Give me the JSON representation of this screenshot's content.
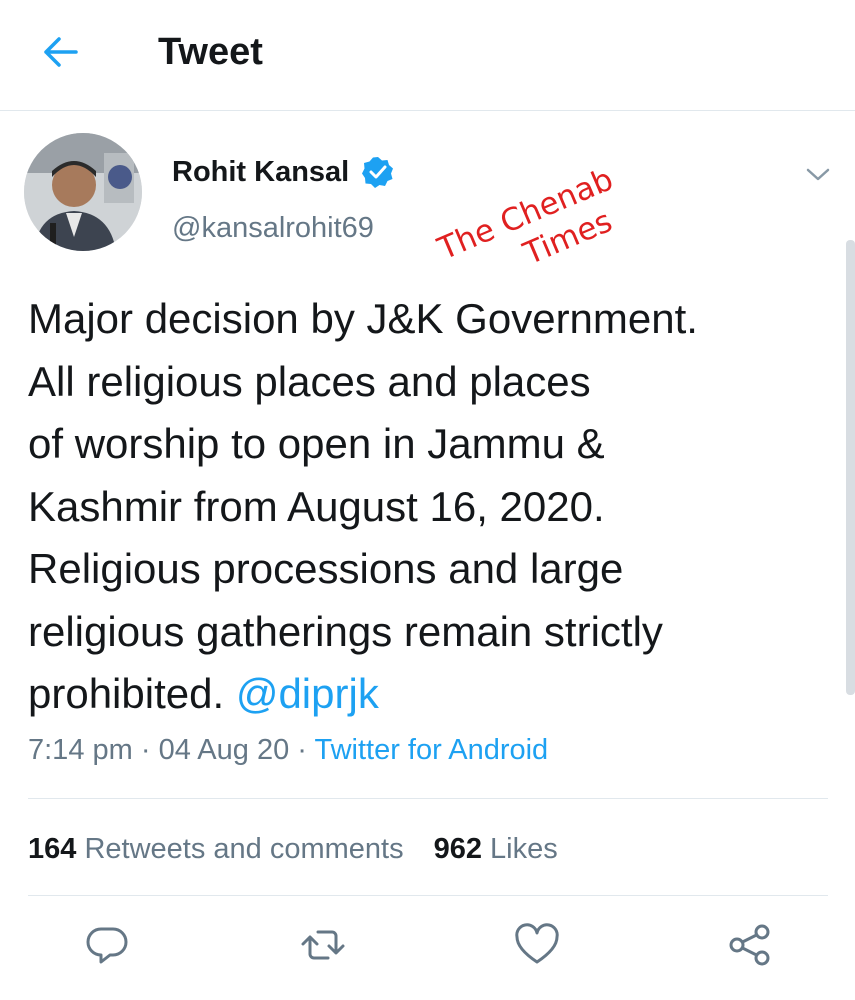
{
  "header": {
    "title": "Tweet",
    "back_icon": "arrow-left-icon"
  },
  "author": {
    "name": "Rohit Kansal",
    "handle": "@kansalrohit69",
    "verified": true,
    "avatar_icon": "user-avatar"
  },
  "watermark": {
    "line1": "The Chenab",
    "line2": "Times",
    "color": "#e02020"
  },
  "tweet": {
    "lines": [
      "Major decision by J&K Government.",
      "All religious places and  places",
      "of worship to open in Jammu &",
      "Kashmir from August 16, 2020.",
      "Religious processions and large",
      "religious gatherings remain strictly"
    ],
    "last_line_text": "prohibited. ",
    "mention": "@diprjk"
  },
  "meta": {
    "time": "7:14 pm",
    "separator": " · ",
    "date": "04 Aug 20",
    "source": "Twitter for Android"
  },
  "stats": {
    "retweets_count": "164",
    "retweets_label": " Retweets and comments",
    "likes_count": "962",
    "likes_label": " Likes"
  },
  "actions": [
    {
      "icon": "reply-icon"
    },
    {
      "icon": "retweet-icon"
    },
    {
      "icon": "like-icon"
    },
    {
      "icon": "share-icon"
    }
  ],
  "colors": {
    "accent": "#1da1f2",
    "text": "#14171a",
    "secondary_text": "#657786",
    "divider": "#e1e8ed",
    "watermark": "#e02020"
  }
}
